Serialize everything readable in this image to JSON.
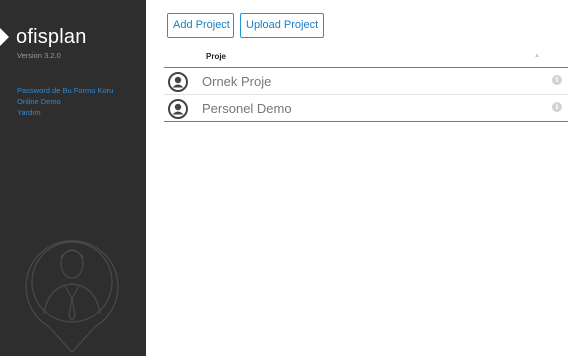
{
  "sidebar": {
    "app_name": "ofisplan",
    "version": "Version 3.2.0",
    "links": [
      {
        "label": "Password de Bu Formu Koru"
      },
      {
        "label": "Online Demo"
      },
      {
        "label": "Yardım"
      }
    ]
  },
  "toolbar": {
    "add_label": "Add Project",
    "upload_label": "Upload Project"
  },
  "table": {
    "column_header": "Proje",
    "sort_icon": "sort-up-icon",
    "rows": [
      {
        "name": "Ornek Proje",
        "icon": "user-circle-icon",
        "action_icon": "info-icon"
      },
      {
        "name": "Personel Demo",
        "icon": "user-circle-icon",
        "action_icon": "info-icon"
      }
    ]
  },
  "colors": {
    "sidebar_bg": "#2e2e2e",
    "link": "#2f8ad6",
    "button_border": "#2196d3",
    "button_text": "#1a7ec4"
  }
}
